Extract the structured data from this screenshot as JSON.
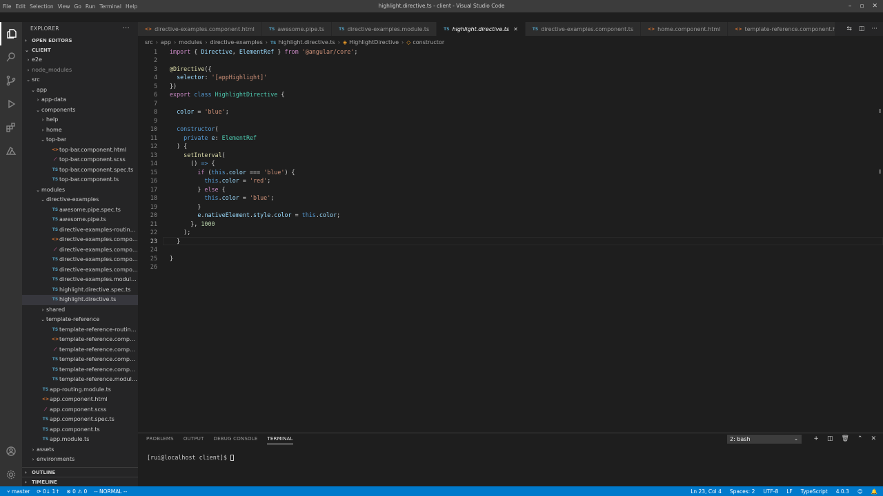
{
  "window": {
    "title": "highlight.directive.ts - client - Visual Studio Code",
    "menu": [
      "File",
      "Edit",
      "Selection",
      "View",
      "Go",
      "Run",
      "Terminal",
      "Help"
    ]
  },
  "sidebar": {
    "header": "EXPLORER",
    "open_editors": "OPEN EDITORS",
    "root": "CLIENT",
    "tree": [
      {
        "label": "e2e",
        "depth": 1,
        "kind": "folder",
        "open": false
      },
      {
        "label": "node_modules",
        "depth": 1,
        "kind": "folder",
        "open": false,
        "dim": true
      },
      {
        "label": "src",
        "depth": 1,
        "kind": "folder",
        "open": true
      },
      {
        "label": "app",
        "depth": 2,
        "kind": "folder",
        "open": true
      },
      {
        "label": "app-data",
        "depth": 3,
        "kind": "folder",
        "open": false
      },
      {
        "label": "components",
        "depth": 3,
        "kind": "folder",
        "open": true
      },
      {
        "label": "help",
        "depth": 4,
        "kind": "folder",
        "open": false
      },
      {
        "label": "home",
        "depth": 4,
        "kind": "folder",
        "open": false
      },
      {
        "label": "top-bar",
        "depth": 4,
        "kind": "folder",
        "open": true
      },
      {
        "label": "top-bar.component.html",
        "depth": 5,
        "kind": "html"
      },
      {
        "label": "top-bar.component.scss",
        "depth": 5,
        "kind": "scss"
      },
      {
        "label": "top-bar.component.spec.ts",
        "depth": 5,
        "kind": "ts"
      },
      {
        "label": "top-bar.component.ts",
        "depth": 5,
        "kind": "ts"
      },
      {
        "label": "modules",
        "depth": 3,
        "kind": "folder",
        "open": true
      },
      {
        "label": "directive-examples",
        "depth": 4,
        "kind": "folder",
        "open": true
      },
      {
        "label": "awesome.pipe.spec.ts",
        "depth": 5,
        "kind": "ts"
      },
      {
        "label": "awesome.pipe.ts",
        "depth": 5,
        "kind": "ts"
      },
      {
        "label": "directive-examples-routing.m...",
        "depth": 5,
        "kind": "ts"
      },
      {
        "label": "directive-examples.componen...",
        "depth": 5,
        "kind": "html"
      },
      {
        "label": "directive-examples.componen...",
        "depth": 5,
        "kind": "scss"
      },
      {
        "label": "directive-examples.componen...",
        "depth": 5,
        "kind": "ts"
      },
      {
        "label": "directive-examples.componen...",
        "depth": 5,
        "kind": "ts"
      },
      {
        "label": "directive-examples.module.ts",
        "depth": 5,
        "kind": "ts"
      },
      {
        "label": "highlight.directive.spec.ts",
        "depth": 5,
        "kind": "ts"
      },
      {
        "label": "highlight.directive.ts",
        "depth": 5,
        "kind": "ts",
        "selected": true
      },
      {
        "label": "shared",
        "depth": 4,
        "kind": "folder",
        "open": false
      },
      {
        "label": "template-reference",
        "depth": 4,
        "kind": "folder",
        "open": true
      },
      {
        "label": "template-reference-routing.m...",
        "depth": 5,
        "kind": "ts"
      },
      {
        "label": "template-reference.compone...",
        "depth": 5,
        "kind": "html"
      },
      {
        "label": "template-reference.compone...",
        "depth": 5,
        "kind": "scss"
      },
      {
        "label": "template-reference.compone...",
        "depth": 5,
        "kind": "ts"
      },
      {
        "label": "template-reference.compone...",
        "depth": 5,
        "kind": "ts"
      },
      {
        "label": "template-reference.module.ts",
        "depth": 5,
        "kind": "ts"
      },
      {
        "label": "app-routing.module.ts",
        "depth": 3,
        "kind": "ts"
      },
      {
        "label": "app.component.html",
        "depth": 3,
        "kind": "html"
      },
      {
        "label": "app.component.scss",
        "depth": 3,
        "kind": "scss"
      },
      {
        "label": "app.component.spec.ts",
        "depth": 3,
        "kind": "ts"
      },
      {
        "label": "app.component.ts",
        "depth": 3,
        "kind": "ts"
      },
      {
        "label": "app.module.ts",
        "depth": 3,
        "kind": "ts"
      },
      {
        "label": "assets",
        "depth": 2,
        "kind": "folder",
        "open": false
      },
      {
        "label": "environments",
        "depth": 2,
        "kind": "folder",
        "open": false
      }
    ],
    "outline": "OUTLINE",
    "timeline": "TIMELINE"
  },
  "tabs": [
    {
      "label": "directive-examples.component.html",
      "icon": "html",
      "active": false
    },
    {
      "label": "awesome.pipe.ts",
      "icon": "ts",
      "active": false
    },
    {
      "label": "directive-examples.module.ts",
      "icon": "ts",
      "active": false
    },
    {
      "label": "highlight.directive.ts",
      "icon": "ts",
      "active": true
    },
    {
      "label": "directive-examples.component.ts",
      "icon": "ts",
      "active": false
    },
    {
      "label": "home.component.html",
      "icon": "html",
      "active": false
    },
    {
      "label": "template-reference.component.html",
      "icon": "html",
      "active": false
    }
  ],
  "breadcrumb": [
    "src",
    "app",
    "modules",
    "directive-examples",
    "highlight.directive.ts",
    "HighlightDirective",
    "constructor"
  ],
  "editor": {
    "current_line": 23,
    "lines": [
      [
        [
          "k",
          "import"
        ],
        [
          "p",
          " { "
        ],
        [
          "v",
          "Directive"
        ],
        [
          "p",
          ", "
        ],
        [
          "v",
          "ElementRef"
        ],
        [
          "p",
          " } "
        ],
        [
          "k",
          "from"
        ],
        [
          "p",
          " "
        ],
        [
          "s",
          "'@angular/core'"
        ],
        [
          "p",
          ";"
        ]
      ],
      [],
      [
        [
          "dec",
          "@Directive"
        ],
        [
          "p",
          "({"
        ]
      ],
      [
        [
          "p",
          "  "
        ],
        [
          "v",
          "selector"
        ],
        [
          "p",
          ": "
        ],
        [
          "s",
          "'[appHighlight]'"
        ]
      ],
      [
        [
          "p",
          "})"
        ]
      ],
      [
        [
          "k",
          "export"
        ],
        [
          "p",
          " "
        ],
        [
          "kb",
          "class"
        ],
        [
          "p",
          " "
        ],
        [
          "t",
          "HighlightDirective"
        ],
        [
          "p",
          " {"
        ]
      ],
      [],
      [
        [
          "p",
          "  "
        ],
        [
          "v",
          "color"
        ],
        [
          "p",
          " = "
        ],
        [
          "s",
          "'blue'"
        ],
        [
          "p",
          ";"
        ]
      ],
      [],
      [
        [
          "p",
          "  "
        ],
        [
          "kb",
          "constructor"
        ],
        [
          "p",
          "("
        ]
      ],
      [
        [
          "p",
          "    "
        ],
        [
          "kb",
          "private"
        ],
        [
          "p",
          " "
        ],
        [
          "v",
          "e"
        ],
        [
          "p",
          ": "
        ],
        [
          "t",
          "ElementRef"
        ]
      ],
      [
        [
          "p",
          "  ) {"
        ]
      ],
      [
        [
          "p",
          "    "
        ],
        [
          "f",
          "setInterval"
        ],
        [
          "p",
          "("
        ]
      ],
      [
        [
          "p",
          "      () "
        ],
        [
          "kb",
          "=>"
        ],
        [
          "p",
          " {"
        ]
      ],
      [
        [
          "p",
          "        "
        ],
        [
          "k",
          "if"
        ],
        [
          "p",
          " ("
        ],
        [
          "kb",
          "this"
        ],
        [
          "p",
          "."
        ],
        [
          "v",
          "color"
        ],
        [
          "p",
          " === "
        ],
        [
          "s",
          "'blue'"
        ],
        [
          "p",
          ") {"
        ]
      ],
      [
        [
          "p",
          "          "
        ],
        [
          "kb",
          "this"
        ],
        [
          "p",
          "."
        ],
        [
          "v",
          "color"
        ],
        [
          "p",
          " = "
        ],
        [
          "s",
          "'red'"
        ],
        [
          "p",
          ";"
        ]
      ],
      [
        [
          "p",
          "        } "
        ],
        [
          "k",
          "else"
        ],
        [
          "p",
          " {"
        ]
      ],
      [
        [
          "p",
          "          "
        ],
        [
          "kb",
          "this"
        ],
        [
          "p",
          "."
        ],
        [
          "v",
          "color"
        ],
        [
          "p",
          " = "
        ],
        [
          "s",
          "'blue'"
        ],
        [
          "p",
          ";"
        ]
      ],
      [
        [
          "p",
          "        }"
        ]
      ],
      [
        [
          "p",
          "        "
        ],
        [
          "v",
          "e"
        ],
        [
          "p",
          "."
        ],
        [
          "v",
          "nativeElement"
        ],
        [
          "p",
          "."
        ],
        [
          "v",
          "style"
        ],
        [
          "p",
          "."
        ],
        [
          "v",
          "color"
        ],
        [
          "p",
          " = "
        ],
        [
          "kb",
          "this"
        ],
        [
          "p",
          "."
        ],
        [
          "v",
          "color"
        ],
        [
          "p",
          ";"
        ]
      ],
      [
        [
          "p",
          "      }, "
        ],
        [
          "n",
          "1000"
        ]
      ],
      [
        [
          "p",
          "    );"
        ]
      ],
      [
        [
          "p",
          "  }"
        ]
      ],
      [],
      [
        [
          "p",
          "}"
        ]
      ],
      []
    ]
  },
  "panel": {
    "tabs": [
      "PROBLEMS",
      "OUTPUT",
      "DEBUG CONSOLE",
      "TERMINAL"
    ],
    "active_tab": "TERMINAL",
    "terminal_select": "2: bash",
    "prompt": "[rui@localhost client]$ "
  },
  "status": {
    "branch": "master",
    "sync": "0↓ 1↑",
    "problems": "⊗ 0 ⚠ 0",
    "mode": "-- NORMAL --",
    "position": "Ln 23, Col 4",
    "spaces": "Spaces: 2",
    "encoding": "UTF-8",
    "eol": "LF",
    "language": "TypeScript",
    "version": "4.0.3"
  }
}
